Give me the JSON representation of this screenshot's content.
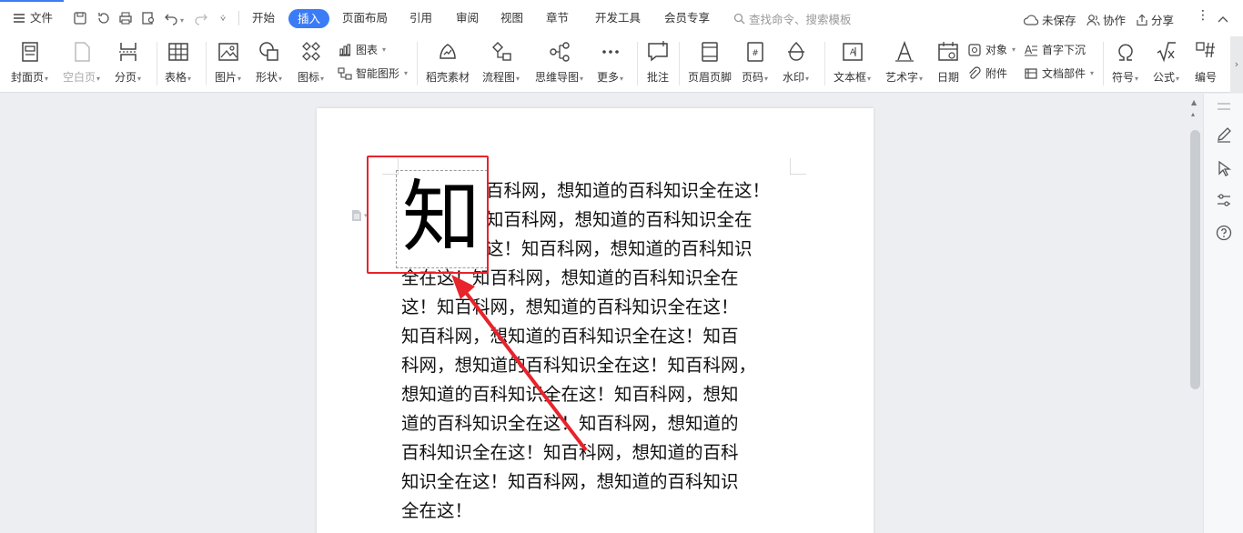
{
  "menubar": {
    "file_label": "文件",
    "tabs": [
      "开始",
      "插入",
      "页面布局",
      "引用",
      "审阅",
      "视图",
      "章节",
      "开发工具",
      "会员专享"
    ],
    "active_tab": "插入",
    "search_placeholder": "查找命令、搜索模板",
    "unsaved_label": "未保存",
    "collab_label": "协作",
    "share_label": "分享"
  },
  "ribbon": {
    "cover_page": "封面页",
    "blank_page": "空白页",
    "page_break": "分页",
    "table": "表格",
    "picture": "图片",
    "shape": "形状",
    "icon": "图标",
    "chart": "图表",
    "smart_art": "智能图形",
    "docer_material": "稻壳素材",
    "flowchart": "流程图",
    "mind_map": "思维导图",
    "more": "更多",
    "comment": "批注",
    "header_footer": "页眉页脚",
    "page_number": "页码",
    "watermark": "水印",
    "text_box": "文本框",
    "word_art": "艺术字",
    "date": "日期",
    "object": "对象",
    "attachment": "附件",
    "drop_cap": "首字下沉",
    "doc_parts": "文档部件",
    "symbol": "符号",
    "formula": "公式",
    "numbering": "编号"
  },
  "document": {
    "drop_cap_char": "知",
    "lines": [
      "百科网，想知道的百科知识全在这！",
      "知百科网，想知道的百科知识全在",
      "这！知百科网，想知道的百科知识",
      "全在这！知百科网，想知道的百科知识全在",
      "这！知百科网，想知道的百科知识全在这！",
      "知百科网，想知道的百科知识全在这！知百",
      "科网，想知道的百科知识全在这！知百科网，",
      "想知道的百科知识全在这！知百科网，想知",
      "道的百科知识全在这！知百科网，想知道的",
      "百科知识全在这！知百科网，想知道的百科",
      "知识全在这！知百科网，想知道的百科知识",
      "全在这！"
    ]
  },
  "colors": {
    "accent": "#3b7cf6",
    "annotation_red": "#e8232b"
  }
}
